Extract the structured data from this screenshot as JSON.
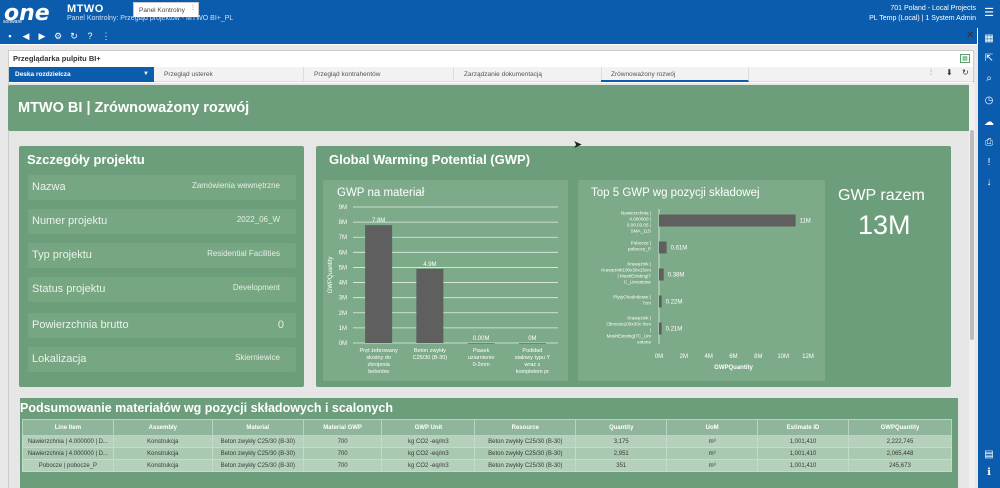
{
  "app": {
    "logo": "one",
    "logo_sub": "software",
    "brand": "MTWO",
    "subtitle": "Panel Kontrolny: Przegląd projektów - MTWO BI+_PL",
    "user_line1": "701 Poland - Local Projects",
    "user_line2": "PL Temp (Local) | 1 System Admin"
  },
  "tabs": [
    {
      "label": "Panel Kontrolny"
    }
  ],
  "panel": {
    "title": "Przeglądarka pulpitu BI+"
  },
  "nav": {
    "dropdown": "Deska rozdzielcza",
    "tabs": [
      "Przegląd usterek",
      "Przegląd kontrahentów",
      "Zarządzanie dokumentacją",
      "Zrównoważony rozwój"
    ]
  },
  "dashboard": {
    "title": "MTWO BI | Zrównoważony rozwój"
  },
  "project": {
    "title": "Szczegóły projektu",
    "fields": [
      {
        "label": "Nazwa",
        "value": "Zamówienia wewnętrzne"
      },
      {
        "label": "Numer projektu",
        "value": "2022_06_W"
      },
      {
        "label": "Typ projektu",
        "value": "Residential Facilities"
      },
      {
        "label": "Status projektu",
        "value": "Development"
      },
      {
        "label": "Powierzchnia brutto",
        "value": "0"
      },
      {
        "label": "Lokalizacja",
        "value": "Skierniewice"
      }
    ]
  },
  "gwp": {
    "title": "Global Warming Potential (GWP)",
    "total_label": "GWP razem",
    "total_value": "13M"
  },
  "chart_data": [
    {
      "type": "bar",
      "title": "GWP na materiał",
      "ylabel": "GWPQuantity",
      "xlabel": "",
      "categories": [
        "Pręt żebrowany skośny do zbrojenia betonów",
        "Beton zwykły C25/30 (B-30)",
        "Piasek uziarnienie 0-2mm",
        "Podkład stalowy typu Y wraz z kompletem pr"
      ],
      "values": [
        7800000,
        4900000,
        0,
        0
      ],
      "data_labels": [
        "7.8M",
        "4.9M",
        "0.00M",
        "0M"
      ],
      "yticks": [
        "0M",
        "1M",
        "2M",
        "3M",
        "4M",
        "5M",
        "6M",
        "7M",
        "8M",
        "9M"
      ],
      "ylim": [
        0,
        9000000
      ],
      "grid": true
    },
    {
      "type": "bar",
      "orientation": "horizontal",
      "title": "Top 5 GWP wg pozycji składowej",
      "xlabel": "GWPQuantity",
      "ylabel": "",
      "categories": [
        "Nawierzchnia | 4.000000 | 0.06.03.05 | SMA_11S",
        "Pobocze | pobocze_P",
        "Krawężnik | Krawężnik100x30x15cm | MeshExisting|7 C_Limestone",
        "PłytyChodnikowe | 7cm",
        "Krawężnik | Obrzeże100x30x 8cm | MeshExisting|7C_Lim estone"
      ],
      "values": [
        11000000,
        610000,
        380000,
        220000,
        210000
      ],
      "data_labels": [
        "11M",
        "0.61M",
        "0.38M",
        "0.22M",
        "0.21M"
      ],
      "xticks": [
        "0M",
        "2M",
        "4M",
        "6M",
        "8M",
        "10M",
        "12M"
      ],
      "xlim": [
        0,
        12000000
      ]
    }
  ],
  "table": {
    "title": "Podsumowanie materiałów wg pozycji składowych i scalonych",
    "headers": [
      "Line Item",
      "Assembly",
      "Material",
      "Material GWP",
      "GWP Unit",
      "Resource",
      "Quantity",
      "UoM",
      "Estimate ID",
      "GWPQuantity"
    ],
    "rows": [
      [
        "Nawierzchnia | 4.000000 | D...",
        "Konstrukcja",
        "Beton zwykły C25/30 (B-30)",
        "700",
        "kg CO2 -eq/m3",
        "Beton zwykły C25/30 (B-30)",
        "3,175",
        "m³",
        "1,001,410",
        "2,222,745"
      ],
      [
        "Nawierzchnia | 4.000000 | D...",
        "Konstrukcja",
        "Beton zwykły C25/30 (B-30)",
        "700",
        "kg CO2 -eq/m3",
        "Beton zwykły C25/30 (B-30)",
        "2,951",
        "m³",
        "1,001,410",
        "2,065,448"
      ],
      [
        "Pobocze | pobocze_P",
        "Konstrukcja",
        "Beton zwykły C25/30 (B-30)",
        "700",
        "kg CO2 -eq/m3",
        "Beton zwykły C25/30 (B-30)",
        "351",
        "m³",
        "1,001,410",
        "245,673"
      ]
    ]
  }
}
